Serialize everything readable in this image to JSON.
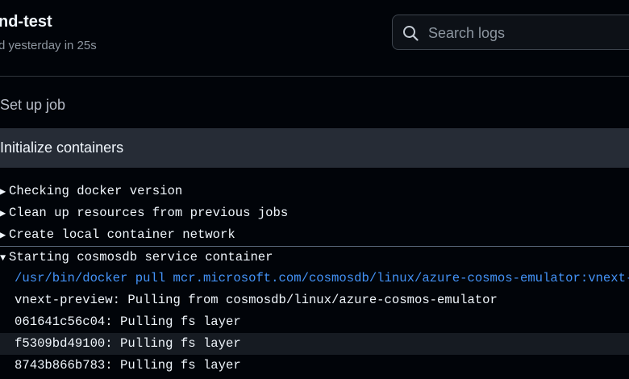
{
  "header": {
    "title": "nd-test",
    "subtitle": "d yesterday in 25s"
  },
  "search": {
    "placeholder": "Search logs",
    "icon": "search-icon"
  },
  "steps": [
    {
      "label": "Set up job",
      "expanded": false
    },
    {
      "label": "Initialize containers",
      "expanded": true
    }
  ],
  "log": {
    "groups": [
      {
        "arrow": "▶",
        "text": "Checking docker version"
      },
      {
        "arrow": "▶",
        "text": "Clean up resources from previous jobs"
      },
      {
        "arrow": "▶",
        "text": "Create local container network"
      },
      {
        "arrow": "▼",
        "text": "Starting cosmosdb service container"
      }
    ],
    "lines": [
      "/usr/bin/docker pull mcr.microsoft.com/cosmosdb/linux/azure-cosmos-emulator:vnext-preview",
      "vnext-preview: Pulling from cosmosdb/linux/azure-cosmos-emulator",
      "061641c56c04: Pulling fs layer",
      "f5309bd49100: Pulling fs layer",
      "8743b866b783: Pulling fs layer"
    ]
  },
  "colors": {
    "background": "#010409",
    "command": "#4493f8",
    "active_step": "#262c36"
  }
}
